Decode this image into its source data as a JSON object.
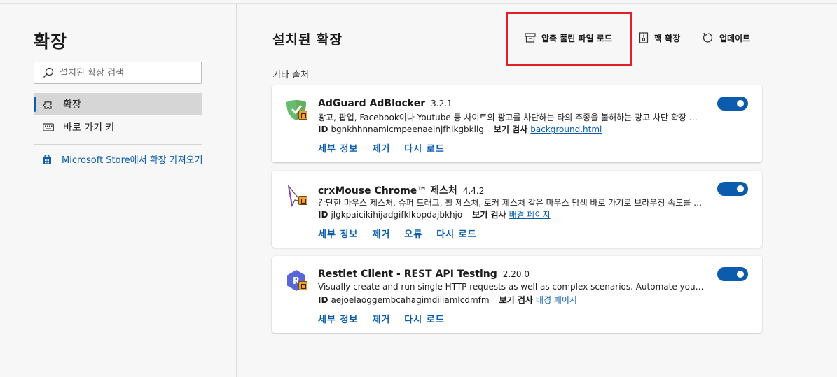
{
  "sidebar": {
    "title": "확장",
    "search_placeholder": "설치된 확장 검색",
    "items": [
      {
        "label": "확장",
        "icon": "puzzle-icon"
      },
      {
        "label": "바로 가기 키",
        "icon": "keyboard-icon"
      }
    ],
    "store_link": "Microsoft Store에서 확장 가져오기"
  },
  "main": {
    "title": "설치된 확장",
    "toolbar": {
      "load_unpacked": "압축 풀린 파일 로드",
      "pack": "팩 확장",
      "update": "업데이트"
    },
    "section_label": "기타 출처"
  },
  "extensions": [
    {
      "name": "AdGuard AdBlocker",
      "version": "3.2.1",
      "description": "광고, 팝업, Facebook이나 Youtube 등 사이트의 광고를 차단하는 타의 추종을 불허하는 광고 차단 확장 프로그램",
      "id_label": "ID",
      "id": "bgnkhhnnamicmpeenaelnjfhikgbkllg",
      "inspect_label": "보기 검사",
      "inspect_link": "background.html",
      "actions": [
        "세부 정보",
        "제거",
        "다시 로드"
      ],
      "enabled": true,
      "icon": "adguard-shield-icon"
    },
    {
      "name": "crxMouse Chrome™ 제스처",
      "version": "4.4.2",
      "description": "간단한 마우스 제스처, 슈퍼 드래그, 휠 제스처, 로커 제스처 같은 마우스 탐색 바로 가기로 브라우징 속도를 높여 보세요",
      "id_label": "ID",
      "id": "jlgkpaicikihijadgifklkbpdajbkhjo",
      "inspect_label": "보기 검사",
      "inspect_link": "배경 페이지",
      "actions": [
        "세부 정보",
        "제거",
        "오류",
        "다시 로드"
      ],
      "enabled": true,
      "icon": "mouse-cursor-icon"
    },
    {
      "name": "Restlet Client - REST API Testing",
      "version": "2.20.0",
      "description": "Visually create and run single HTTP requests as well as complex scenarios. Automate your API testing",
      "id_label": "ID",
      "id": "aejoelaoggembcahagimdiliamlcdmfm",
      "inspect_label": "보기 검사",
      "inspect_link": "배경 페이지",
      "actions": [
        "세부 정보",
        "제거",
        "다시 로드"
      ],
      "enabled": true,
      "icon": "restlet-hexagon-icon"
    }
  ],
  "colors": {
    "accent": "#0b5cad",
    "highlight": "#e0202a"
  }
}
